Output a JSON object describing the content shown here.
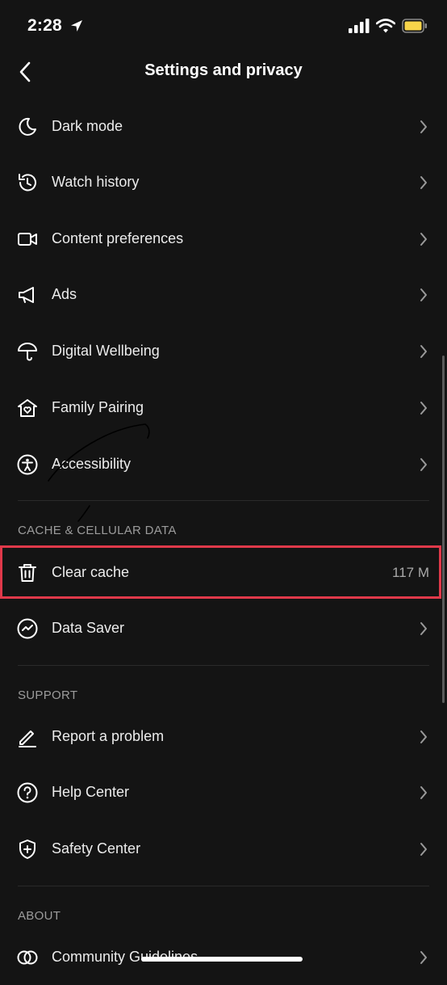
{
  "status_bar": {
    "time": "2:28",
    "icons": [
      "location-arrow-icon",
      "cellular-signal-icon",
      "wifi-icon",
      "battery-icon"
    ],
    "battery_color": "#f7d44a"
  },
  "header": {
    "title": "Settings and privacy",
    "back_icon": "chevron-left-icon"
  },
  "rows": [
    {
      "label": "Dark mode",
      "icon": "moon-icon"
    },
    {
      "label": "Watch history",
      "icon": "history-icon"
    },
    {
      "label": "Content preferences",
      "icon": "video-camera-icon"
    },
    {
      "label": "Ads",
      "icon": "megaphone-icon"
    },
    {
      "label": "Digital Wellbeing",
      "icon": "umbrella-icon"
    },
    {
      "label": "Family Pairing",
      "icon": "house-heart-icon"
    },
    {
      "label": "Accessibility",
      "icon": "accessibility-icon"
    }
  ],
  "cache_section": {
    "header": "CACHE & CELLULAR DATA",
    "clear_cache": {
      "label": "Clear cache",
      "value": "117 M",
      "icon": "trash-icon"
    },
    "data_saver": {
      "label": "Data Saver",
      "icon": "data-saver-icon"
    },
    "highlight_color": "#e0394a"
  },
  "support_section": {
    "header": "SUPPORT",
    "rows": [
      {
        "label": "Report a problem",
        "icon": "pencil-icon"
      },
      {
        "label": "Help Center",
        "icon": "question-circle-icon"
      },
      {
        "label": "Safety Center",
        "icon": "shield-plus-icon"
      }
    ]
  },
  "about_section": {
    "header": "ABOUT",
    "rows": [
      {
        "label": "Community Guidelines",
        "icon": "interlocking-rings-icon"
      }
    ]
  }
}
